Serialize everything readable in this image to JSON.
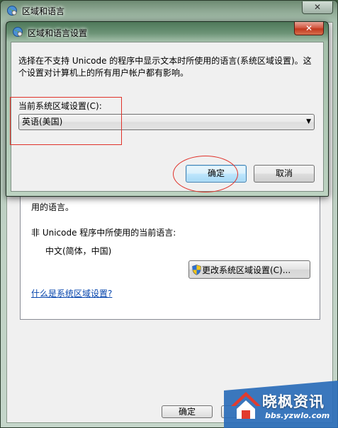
{
  "outer_window": {
    "title": "区域和语言",
    "close_label": "✕",
    "behind_text_1": "用的语言。",
    "non_unicode_label": "非 Unicode 程序中所使用的当前语言:",
    "non_unicode_value": "中文(简体，中国)",
    "change_button": "更改系统区域设置(C)...",
    "what_link": "什么是系统区域设置?",
    "ok_button": "确定"
  },
  "dialog": {
    "title": "区域和语言设置",
    "close_label": "✕",
    "description": "选择在不支持 Unicode 的程序中显示文本时所使用的语言(系统区域设置)。这个设置对计算机上的所有用户帐户都有影响。",
    "locale_label": "当前系统区域设置(C):",
    "locale_selected": "英语(美国)",
    "ok_button": "确定",
    "cancel_button": "取消"
  },
  "watermark": {
    "name": "晓枫资讯",
    "url": "bbs.yzwlo.com"
  },
  "colors": {
    "annotation": "#e0322a",
    "link": "#0645ad"
  }
}
